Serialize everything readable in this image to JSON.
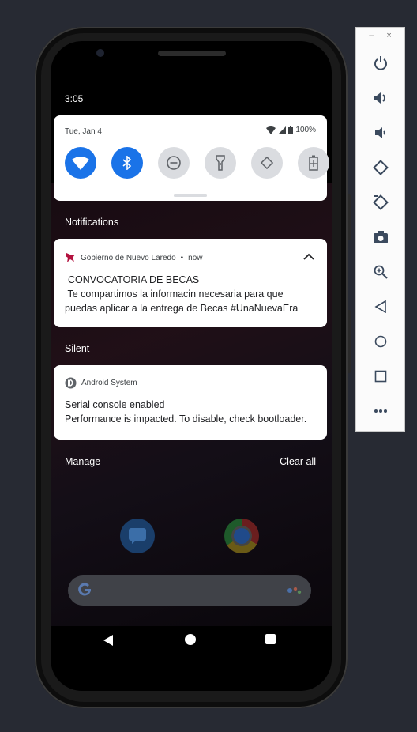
{
  "status_bar": {
    "time": "3:05"
  },
  "quick_settings": {
    "date": "Tue, Jan 4",
    "battery": "100%",
    "tiles": [
      {
        "name": "wifi",
        "active": true
      },
      {
        "name": "bluetooth",
        "active": true
      },
      {
        "name": "do-not-disturb",
        "active": false
      },
      {
        "name": "flashlight",
        "active": false
      },
      {
        "name": "auto-rotate",
        "active": false
      },
      {
        "name": "battery-saver",
        "active": false
      }
    ]
  },
  "sections": {
    "notifications": "Notifications",
    "silent": "Silent"
  },
  "notification_1": {
    "app": "Gobierno de Nuevo Laredo",
    "time": "now",
    "title": "CONVOCATORIA DE BECAS",
    "body": " Te compartimos la informacin necesaria para que puedas aplicar a la entrega de Becas #UnaNuevaEra"
  },
  "notification_2": {
    "app": "Android System",
    "title": "Serial console enabled",
    "body": "Performance is impacted. To disable, check bootloader."
  },
  "footer": {
    "manage": "Manage",
    "clear_all": "Clear all"
  },
  "colors": {
    "accent": "#1a73e8",
    "brand_icon": "#b3123f"
  },
  "emulator_panel": {
    "minimize": "–",
    "close": "×",
    "buttons": [
      "power",
      "volume-up",
      "volume-down",
      "rotate-left",
      "rotate-right",
      "screenshot",
      "zoom",
      "back",
      "home",
      "overview",
      "more"
    ]
  }
}
